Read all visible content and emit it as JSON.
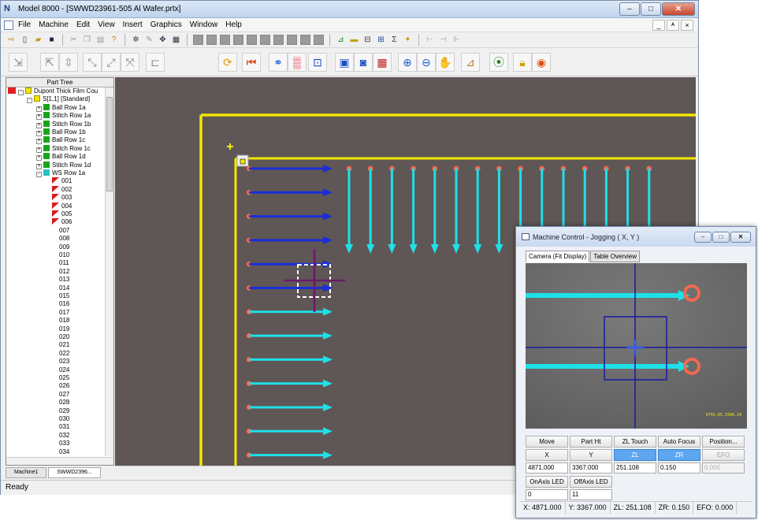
{
  "app": {
    "title": "Model 8000 - [SWWD23961-505 Al Wafer.prtx]",
    "app_icon": "N",
    "menu": [
      "File",
      "Machine",
      "Edit",
      "View",
      "Insert",
      "Graphics",
      "Window",
      "Help"
    ],
    "window_buttons": [
      "–",
      "□",
      "✕"
    ],
    "mdi_buttons": [
      "_",
      "ᴬ",
      "×"
    ]
  },
  "part_tree": {
    "header": "Part Tree",
    "root": "Dupont Thick Film Cou",
    "site": "S[1,1] [Standard]",
    "rows": [
      "Ball Row 1a",
      "Stitch Row 1a",
      "Stitch Row 1b",
      "Ball Row 1b",
      "Ball Row 1c",
      "Stitch Row 1c",
      "Ball Row 1d",
      "Stitch Row 1d",
      "WS Row 1a"
    ],
    "items_red": [
      "001",
      "002",
      "003",
      "004",
      "005",
      "006"
    ],
    "items": [
      "007",
      "008",
      "009",
      "010",
      "011",
      "012",
      "013",
      "014",
      "015",
      "016",
      "017",
      "018",
      "019",
      "020",
      "021",
      "022",
      "023",
      "024",
      "025",
      "026",
      "027",
      "028",
      "029",
      "030",
      "031",
      "032",
      "033",
      "034"
    ]
  },
  "doc_tabs": [
    "Machine1",
    "SWWD2396..."
  ],
  "status_bar": {
    "text": "Ready"
  },
  "colors": {
    "canvas_bg": "#5f5656",
    "outline": "#f2e600",
    "arrow_blue": "#1a2ed8",
    "arrow_cyan": "#1fe0e8",
    "pad": "#f06a50",
    "crosshair": "#6a1a6a"
  },
  "machine_control": {
    "title": "Machine Control - Jogging ( X, Y )",
    "tabs": [
      "Camera (Fit Display)",
      "Table Overview"
    ],
    "camera_readout": "4755.65,3396.24",
    "buttons": [
      "Move",
      "Part Ht",
      "ZL Touch",
      "Auto Focus",
      "Position..."
    ],
    "axis_buttons": [
      "X",
      "Y",
      "ZL",
      "ZR",
      "EFO"
    ],
    "axis_values": [
      "4871.000",
      "3367.000",
      "251.108",
      "0.150",
      "0.000"
    ],
    "led_buttons": [
      "OnAxis LED",
      "OffAxis LED"
    ],
    "led_values": [
      "0",
      "11"
    ],
    "status": [
      "X: 4871.000",
      "Y: 3367.000",
      "ZL: 251.108",
      "ZR: 0.150",
      "EFO: 0.000"
    ]
  }
}
